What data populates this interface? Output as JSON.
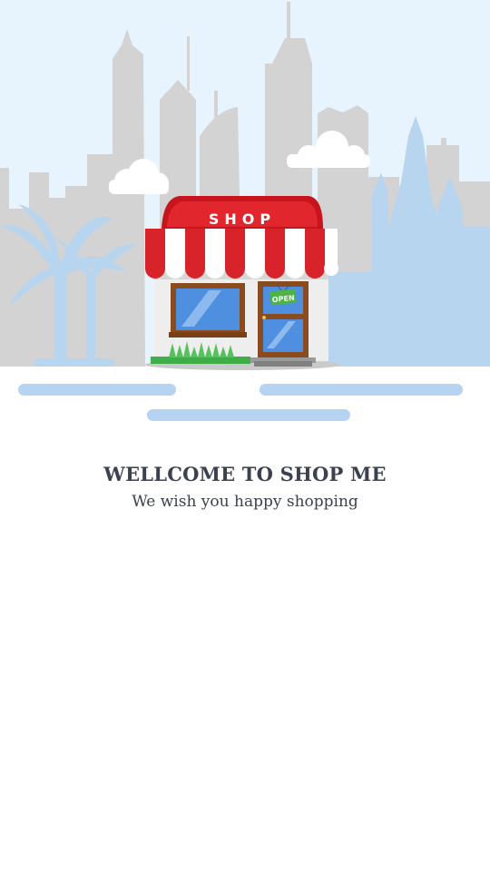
{
  "hero": {
    "shop_sign": "SHOP",
    "door_sign": "OPEN",
    "icons": [
      "city-skyline",
      "cloud",
      "palm-tree",
      "shop-storefront",
      "awning",
      "grass"
    ],
    "colors": {
      "sky": "#e8f4fd",
      "buildings": "#d3d3d3",
      "buildings_blue": "#b8d5f0",
      "awning_red": "#d8232a",
      "awning_white": "#ffffff",
      "door_sign": "#4bb543",
      "pill": "#b6d3f1"
    }
  },
  "welcome": {
    "title": "WELLCOME TO SHOP ME",
    "subtitle": "We wish you happy shopping"
  },
  "colors": {
    "text": "#3a4250",
    "background": "#ffffff"
  }
}
